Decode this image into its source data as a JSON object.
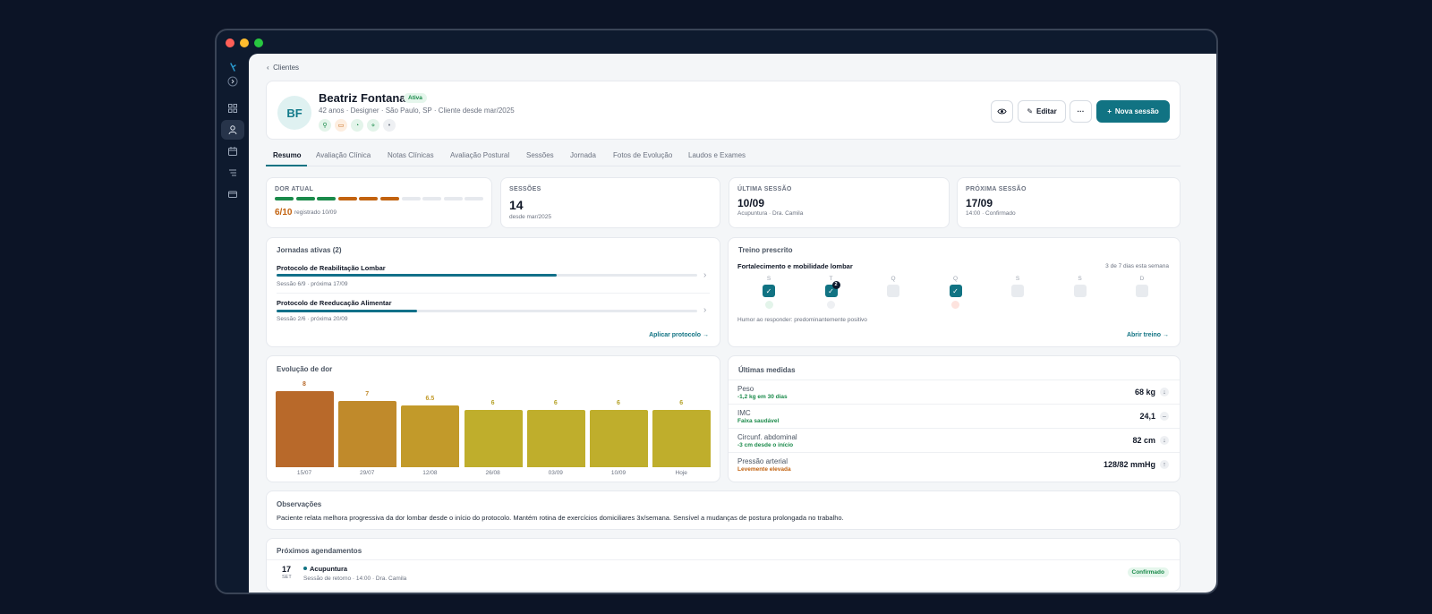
{
  "breadcrumb": {
    "label": "Clientes"
  },
  "patient": {
    "initials": "BF",
    "name": "Beatriz Fontana",
    "status": "Ativa",
    "subtitle": "42 anos · Designer · São Paulo, SP · Cliente desde mar/2025",
    "tags": [
      "person-icon",
      "message-icon",
      "bell-icon",
      "share-icon",
      "pin-icon"
    ]
  },
  "actions": {
    "view_icon": "eye-icon",
    "edit": "Editar",
    "more": "···",
    "new_session": "Nova sessão"
  },
  "tabs": [
    "Resumo",
    "Avaliação Clínica",
    "Notas Clínicas",
    "Avaliação Postural",
    "Sessões",
    "Jornada",
    "Fotos de Evolução",
    "Laudos e Exames"
  ],
  "stats": {
    "pain": {
      "label": "DOR ATUAL",
      "value": "6/10",
      "sub": "registrado 10/09",
      "level": 6,
      "max": 10
    },
    "sessions": {
      "label": "SESSÕES",
      "value": "14",
      "sub": "desde mar/2025"
    },
    "last": {
      "label": "ÚLTIMA SESSÃO",
      "value": "10/09",
      "sub": "Acupuntura · Dra. Camila"
    },
    "next": {
      "label": "PRÓXIMA SESSÃO",
      "value": "17/09",
      "sub": "14:00 · Confirmado"
    }
  },
  "journeys": {
    "title": "Jornadas ativas (2)",
    "items": [
      {
        "title": "Protocolo de Reabilitação Lombar",
        "sub": "Sessão 6/9 · próxima 17/09",
        "progress": 0.667
      },
      {
        "title": "Protocolo de Reeducação Alimentar",
        "sub": "Sessão 2/6 · próxima 20/09",
        "progress": 0.333
      }
    ],
    "link": "Aplicar protocolo →"
  },
  "training": {
    "title": "Treino prescrito",
    "plan": "Fortalecimento e mobilidade lombar",
    "week_info": "3 de 7 dias esta semana",
    "days": [
      "S",
      "T",
      "Q",
      "Q",
      "S",
      "S",
      "D"
    ],
    "done": [
      true,
      true,
      false,
      true,
      false,
      false,
      false
    ],
    "badge_day": "2",
    "mood": "Humor ao responder: predominantemente positivo",
    "link": "Abrir treino →"
  },
  "pain_chart": {
    "title": "Evolução de dor",
    "chart_data": {
      "type": "bar",
      "categories": [
        "15/07",
        "29/07",
        "12/08",
        "26/08",
        "03/09",
        "10/09",
        "Hoje"
      ],
      "values": [
        8,
        7,
        6.5,
        6,
        6,
        6,
        6
      ],
      "value_labels": [
        "8",
        "7",
        "6.5",
        "6",
        "6",
        "6",
        "6"
      ],
      "ylim": [
        0,
        10
      ],
      "colors": [
        "#b8692a",
        "#c08a2b",
        "#c29a2a",
        "#bfae2c",
        "#bfae2c",
        "#bfae2c",
        "#bfae2c"
      ],
      "label_colors": [
        "#b8692a",
        "#c08a2b",
        "#c29a2a",
        "#b5a22a",
        "#b5a22a",
        "#b5a22a",
        "#b5a22a"
      ]
    }
  },
  "measures": {
    "title": "Últimas medidas",
    "rows": [
      {
        "label": "Peso",
        "note": "-1,2 kg em 30 dias",
        "value": "68 kg",
        "trend": "↓",
        "note_color": "#1a8a4a"
      },
      {
        "label": "IMC",
        "note": "Faixa saudável",
        "value": "24,1",
        "trend": "–",
        "note_color": "#1a8a4a"
      },
      {
        "label": "Circunf. abdominal",
        "note": "-3 cm desde o início",
        "value": "82 cm",
        "trend": "↓",
        "note_color": "#1a8a4a"
      },
      {
        "label": "Pressão arterial",
        "note": "Levemente elevada",
        "value": "128/82 mmHg",
        "trend": "↑",
        "note_color": "#c2620f"
      }
    ]
  },
  "observations": {
    "title": "Observações",
    "text": "Paciente relata melhora progressiva da dor lombar desde o início do protocolo. Mantém rotina de exercícios domiciliares 3x/semana. Sensível a mudanças de postura prolongada no trabalho."
  },
  "appointments": {
    "title": "Próximos agendamentos",
    "items": [
      {
        "day": "17",
        "month": "SET",
        "title": "Acupuntura",
        "sub": "Sessão de retorno · 14:00 · Dra. Camila",
        "status": "Confirmado"
      }
    ]
  }
}
